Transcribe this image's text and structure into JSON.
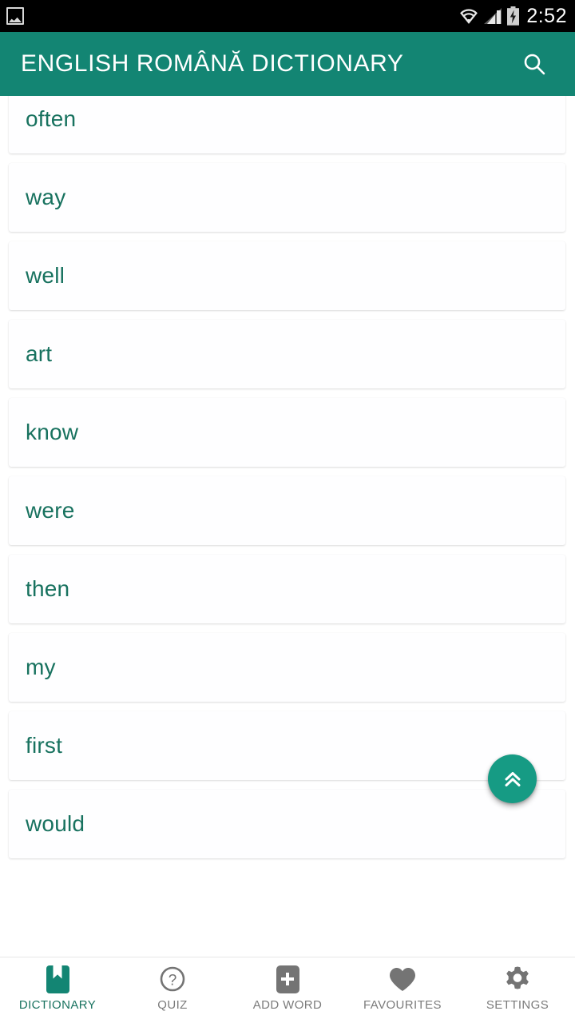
{
  "statusbar": {
    "notification_icon": "image-notification-icon",
    "wifi_icon": "wifi-icon",
    "signal_icon": "cellular-signal-icon",
    "battery_icon": "battery-charging-icon",
    "time": "2:52"
  },
  "appbar": {
    "title": "ENGLISH ROMÂNĂ DICTIONARY",
    "search_icon": "search-icon",
    "background_color": "#138573"
  },
  "word_list": {
    "items": [
      {
        "word": "often"
      },
      {
        "word": "way"
      },
      {
        "word": "well"
      },
      {
        "word": "art"
      },
      {
        "word": "know"
      },
      {
        "word": "were"
      },
      {
        "word": "then"
      },
      {
        "word": "my"
      },
      {
        "word": "first"
      },
      {
        "word": "would"
      }
    ],
    "word_color": "#18725f"
  },
  "fab": {
    "icon": "double-chevron-up-icon",
    "color": "#169b84"
  },
  "bottom_nav": {
    "active_index": 0,
    "active_color": "#18725f",
    "inactive_color": "#7b7b7b",
    "items": [
      {
        "label": "DICTIONARY",
        "icon": "book-bookmark-icon"
      },
      {
        "label": "QUIZ",
        "icon": "question-circle-icon"
      },
      {
        "label": "ADD WORD",
        "icon": "plus-square-icon"
      },
      {
        "label": "FAVOURITES",
        "icon": "heart-icon"
      },
      {
        "label": "SETTINGS",
        "icon": "gear-icon"
      }
    ]
  }
}
